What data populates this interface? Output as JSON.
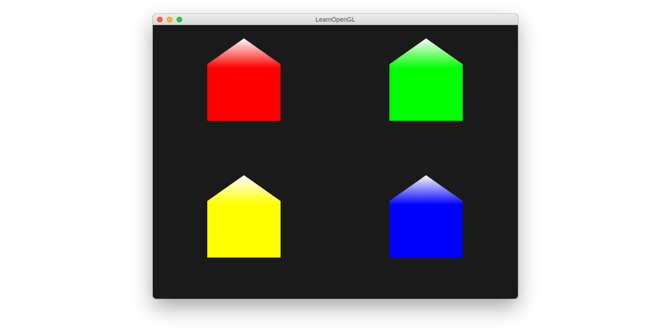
{
  "window": {
    "title": "LearnOpenGL",
    "background_color": "#1a1a1a",
    "controls": [
      {
        "name": "close",
        "color": "#fc5f57"
      },
      {
        "name": "minimize",
        "color": "#fdbc2e"
      },
      {
        "name": "maximize",
        "color": "#28c840"
      }
    ]
  },
  "scene": {
    "houses": [
      {
        "name": "red",
        "color": "#ff0000",
        "tip_color": "#ffffff"
      },
      {
        "name": "green",
        "color": "#00ff00",
        "tip_color": "#ffffff"
      },
      {
        "name": "yellow",
        "color": "#ffff00",
        "tip_color": "#ffffff"
      },
      {
        "name": "blue",
        "color": "#0000ff",
        "tip_color": "#ffffff"
      }
    ]
  }
}
